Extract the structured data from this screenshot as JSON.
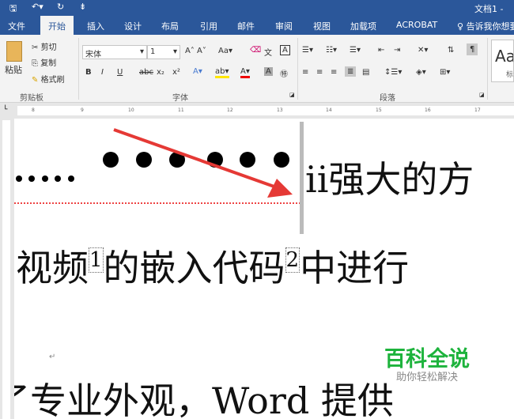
{
  "titlebar": {
    "doc_title": "文档1 -"
  },
  "tabs": [
    "文件",
    "开始",
    "插入",
    "设计",
    "布局",
    "引用",
    "邮件",
    "审阅",
    "视图",
    "加载项",
    "ACROBAT"
  ],
  "tell_me": "告诉我你想要",
  "clipboard": {
    "paste": "粘贴",
    "cut": "剪切",
    "copy": "复制",
    "format_painter": "格式刷",
    "label": "剪贴板"
  },
  "font": {
    "name": "宋体",
    "size": "1",
    "label": "字体",
    "case": "Aa",
    "bold": "B",
    "italic": "I",
    "underline": "U",
    "strike": "abc",
    "sub": "x₂",
    "sup": "x²"
  },
  "paragraph": {
    "label": "段落"
  },
  "styles": {
    "sample": "Aa",
    "name": "标"
  },
  "ruler_ticks": [
    "8",
    "9",
    "10",
    "11",
    "12",
    "13",
    "14",
    "15",
    "16",
    "17"
  ],
  "document": {
    "line1_suffix": "ii强大的方",
    "line2": [
      "视频",
      "1",
      "的嵌入代码",
      "2",
      "中进行"
    ],
    "line3": "了专业外观，Word 提供"
  },
  "watermark": {
    "title": "百科全说",
    "subtitle": "助你轻松解决"
  },
  "colors": {
    "accent": "#2b579a",
    "arrow": "#e53935",
    "watermark": "#1db33c"
  }
}
